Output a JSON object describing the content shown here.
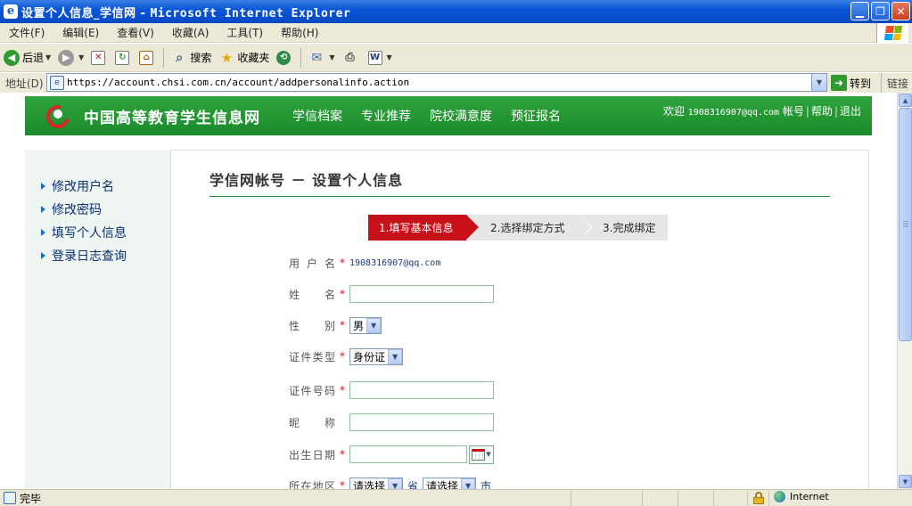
{
  "window": {
    "title_cn": "设置个人信息_学信网 - ",
    "title_app": "Microsoft Internet Explorer"
  },
  "menu": [
    "文件(F)",
    "编辑(E)",
    "查看(V)",
    "收藏(A)",
    "工具(T)",
    "帮助(H)"
  ],
  "toolbar": {
    "back": "后退",
    "search": "搜索",
    "favorites": "收藏夹"
  },
  "address": {
    "label": "地址(D)",
    "url": "https://account.chsi.com.cn/account/addpersonalinfo.action",
    "go": "转到",
    "links": "链接"
  },
  "site": {
    "name": "中国高等教育学生信息网",
    "nav": [
      "学信档案",
      "专业推荐",
      "院校满意度",
      "预征报名"
    ],
    "welcome": "欢迎",
    "user_email": "1908316907@qq.com",
    "account_link": "帐号",
    "help_link": "帮助",
    "logout_link": "退出"
  },
  "sidebar": {
    "items": [
      "修改用户名",
      "修改密码",
      "填写个人信息",
      "登录日志查询"
    ]
  },
  "main": {
    "title": "学信网帐号 － 设置个人信息",
    "steps": [
      "1.填写基本信息",
      "2.选择绑定方式",
      "3.完成绑定"
    ]
  },
  "form": {
    "username_label": "用户名",
    "username_value": "1908316907@qq.com",
    "name_label": "姓名",
    "gender_label": "性别",
    "gender_value": "男",
    "idtype_label": "证件类型",
    "idtype_value": "身份证",
    "idnumber_label": "证件号码",
    "nickname_label": "昵称",
    "birthdate_label": "出生日期",
    "region_label": "所在地区",
    "province_value": "请选择",
    "province_unit": "省",
    "city_value": "请选择",
    "city_unit": "市",
    "required_mark": "*"
  },
  "status": {
    "text": "完毕",
    "zone": "Internet"
  },
  "colors": {
    "site_green": "#1a8a2a",
    "step_active": "#c8101a",
    "required": "#d0101a"
  }
}
